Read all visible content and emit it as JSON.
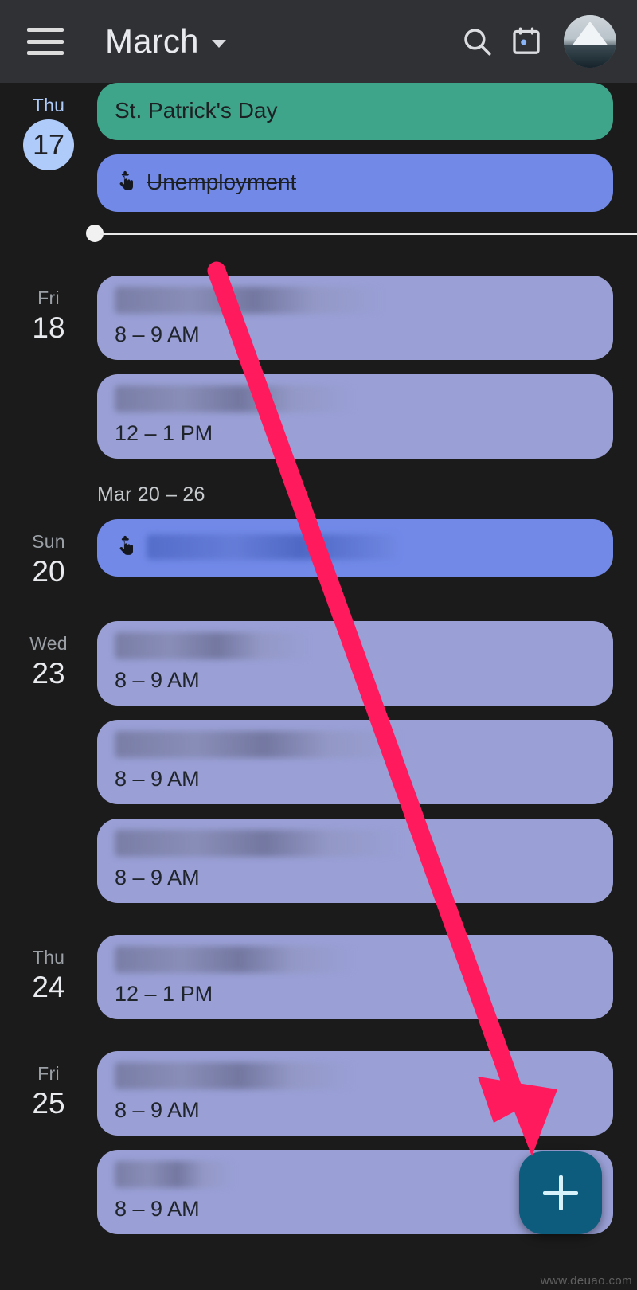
{
  "app": {
    "background_color": "#1b1b1b",
    "topbar_color": "#303134"
  },
  "topbar": {
    "menu_icon": "hamburger-menu-icon",
    "title": "March",
    "dropdown_icon": "chevron-down-icon",
    "search_icon": "search-icon",
    "view_switch_icon": "calendar-day-icon",
    "avatar_icon": "avatar-mountain-image"
  },
  "now_indicator": {
    "label": "current-time-line"
  },
  "schedule": {
    "days": [
      {
        "dow": "Thu",
        "date": "17",
        "is_today": true,
        "events": [
          {
            "style": "green",
            "title": "St. Patrick's Day",
            "time": "",
            "strike": false,
            "icon": "",
            "redacted": false
          },
          {
            "style": "blue",
            "title": "Unemployment",
            "time": "",
            "strike": true,
            "icon": "task-hand-icon",
            "redacted": false
          }
        ]
      },
      {
        "dow": "Fri",
        "date": "18",
        "is_today": false,
        "events": [
          {
            "style": "muted",
            "title": "",
            "time": "8 – 9 AM",
            "redacted": true,
            "width": "w1"
          },
          {
            "style": "muted",
            "title": "",
            "time": "12 – 1 PM",
            "redacted": true,
            "width": "w2"
          }
        ]
      }
    ],
    "week_header": "Mar 20 – 26",
    "week_days": [
      {
        "dow": "Sun",
        "date": "20",
        "is_today": false,
        "events": [
          {
            "style": "blue",
            "title": "",
            "time": "",
            "icon": "task-hand-icon",
            "redacted": true,
            "inline": true
          }
        ]
      },
      {
        "dow": "Wed",
        "date": "23",
        "is_today": false,
        "events": [
          {
            "style": "muted",
            "title": "",
            "time": "8 – 9 AM",
            "redacted": true,
            "width": "w3"
          },
          {
            "style": "muted",
            "title": "",
            "time": "8 – 9 AM",
            "redacted": true,
            "width": "w4"
          },
          {
            "style": "muted",
            "title": "",
            "time": "8 – 9 AM",
            "redacted": true,
            "width": "w4"
          }
        ]
      },
      {
        "dow": "Thu",
        "date": "24",
        "is_today": false,
        "events": [
          {
            "style": "muted",
            "title": "",
            "time": "12 – 1 PM",
            "redacted": true,
            "width": "w2"
          }
        ]
      },
      {
        "dow": "Fri",
        "date": "25",
        "is_today": false,
        "events": [
          {
            "style": "muted",
            "title": "",
            "time": "8 – 9 AM",
            "redacted": true,
            "width": "w2"
          },
          {
            "style": "muted",
            "title": "",
            "time": "8 – 9 AM",
            "redacted": true,
            "width": "w5"
          }
        ]
      }
    ]
  },
  "fab": {
    "label": "+",
    "icon": "plus-icon",
    "color": "#0d5c7d"
  },
  "annotation": {
    "arrow_color": "#ff1a5e",
    "arrow_from": "272,338",
    "arrow_to": "672,1442"
  },
  "watermark": {
    "text": "www.deuao.com"
  },
  "colors": {
    "holiday_green": "#3fa58a",
    "task_blue": "#7289e8",
    "event_muted": "#9aa0d6",
    "today_accent": "#aecbfa",
    "fab": "#0d5c7d",
    "annotation_red": "#ff1a5e"
  }
}
